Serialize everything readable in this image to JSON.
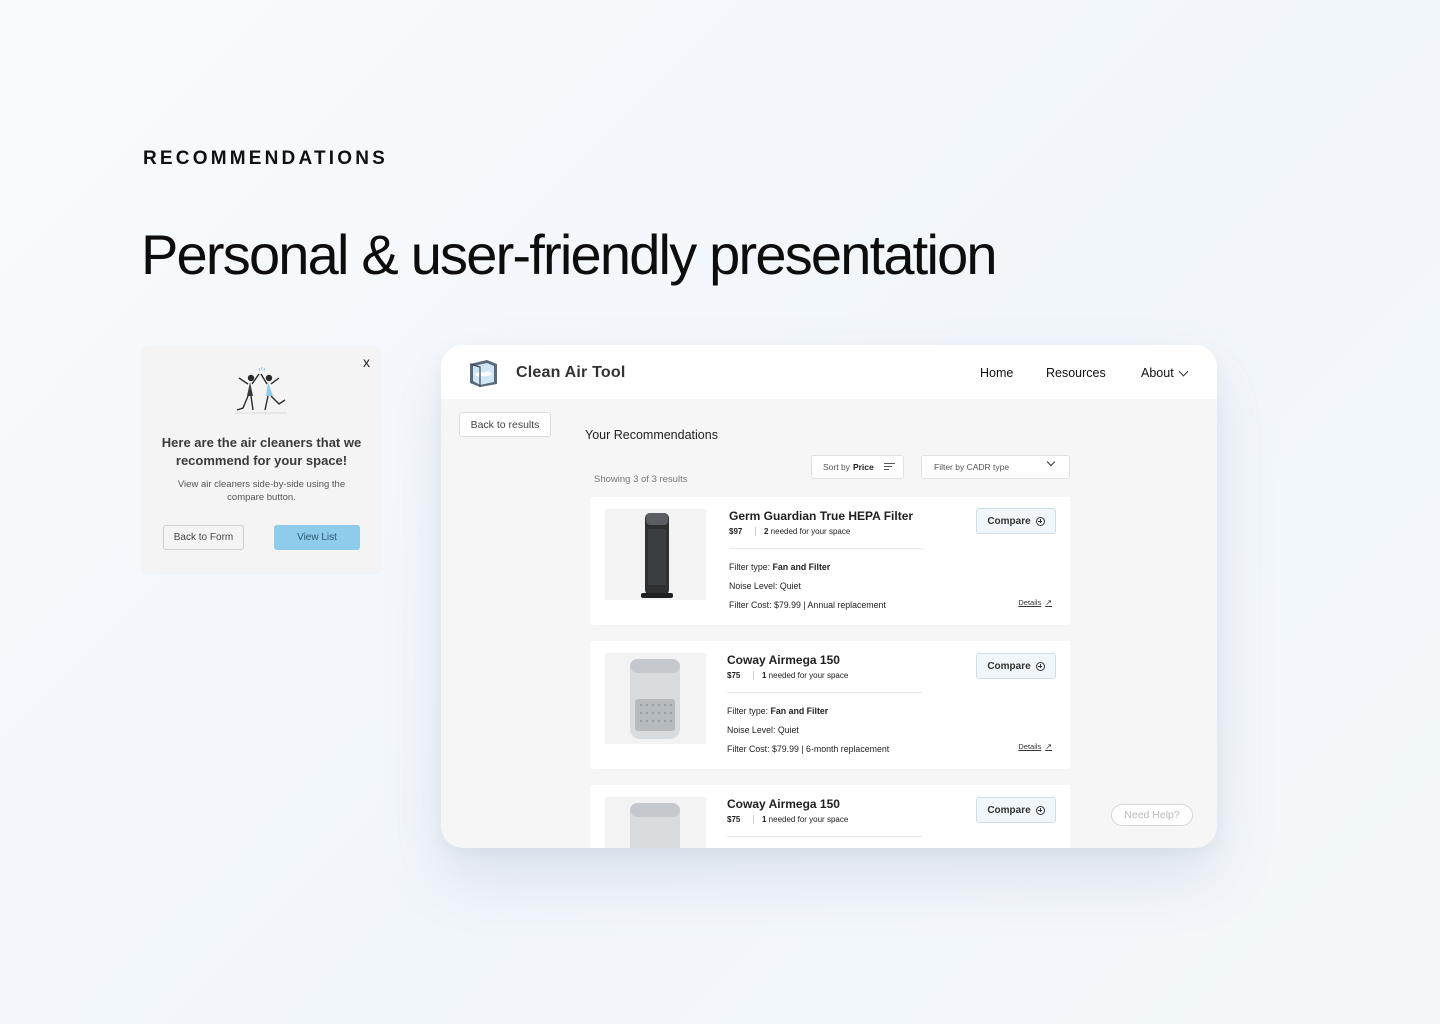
{
  "page": {
    "eyebrow": "RECOMMENDATIONS",
    "headline": "Personal & user-friendly presentation"
  },
  "modal": {
    "close_label": "x",
    "title": "Here are the air cleaners that we recommend for your space!",
    "subtitle": "View air cleaners side-by-side using the compare button.",
    "back_button": "Back to Form",
    "view_button": "View List",
    "illustration_icon": "celebrating-people-icon"
  },
  "app": {
    "brand": "Clean Air Tool",
    "logo_icon": "clean-air-box-icon",
    "nav": {
      "home": "Home",
      "resources": "Resources",
      "about": "About"
    },
    "back_results": "Back to results",
    "section_title": "Your Recommendations",
    "sort": {
      "prefix": "Sort by",
      "value": "Price"
    },
    "filter_placeholder": "Filter by CADR type",
    "showing": "Showing 3 of 3 results",
    "need_help": "Need Help?",
    "colors": {
      "accent": "#8fcbea",
      "compare_bg": "#f1f6fa"
    },
    "products": [
      {
        "name": "Germ Guardian True HEPA Filter",
        "price": "$97",
        "needed_count": "2",
        "needed_text": " needed for your space",
        "filter_type_label": "Filter type: ",
        "filter_type": "Fan and Filter",
        "noise": "Noise Level: Quiet",
        "filter_cost": "Filter Cost: $79.99 | Annual replacement",
        "compare": "Compare",
        "details": "Details"
      },
      {
        "name": "Coway Airmega 150",
        "price": "$75",
        "needed_count": "1",
        "needed_text": " needed for your space",
        "filter_type_label": "Filter type: ",
        "filter_type": "Fan and Filter",
        "noise": "Noise Level: Quiet",
        "filter_cost": "Filter Cost: $79.99 | 6-month replacement",
        "compare": "Compare",
        "details": "Details"
      },
      {
        "name": "Coway Airmega 150",
        "price": "$75",
        "needed_count": "1",
        "needed_text": " needed for your space",
        "compare": "Compare"
      }
    ]
  }
}
